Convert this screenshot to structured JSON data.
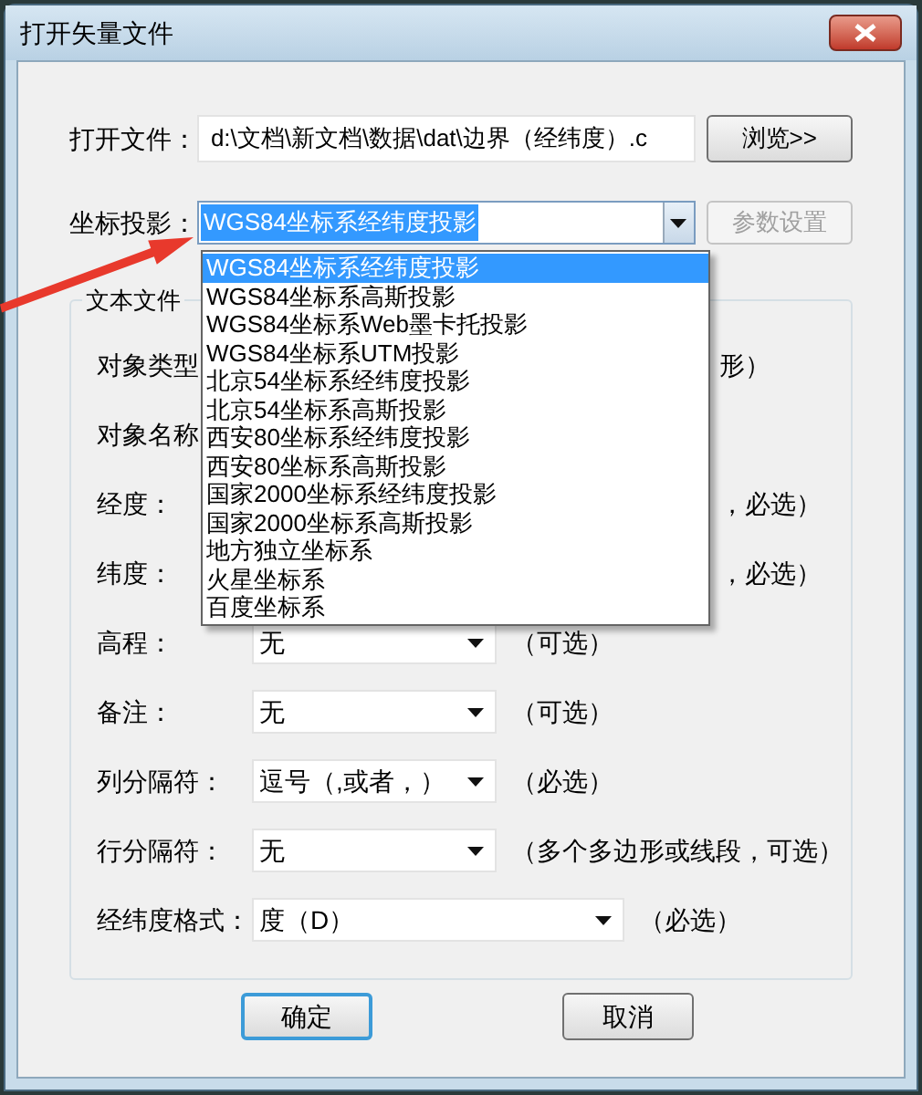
{
  "window": {
    "title": "打开矢量文件"
  },
  "file_row": {
    "label": "打开文件：",
    "value": "d:\\文档\\新文档\\数据\\dat\\边界（经纬度）.c",
    "button": "浏览>>"
  },
  "projection_row": {
    "label": "坐标投影：",
    "value": "WGS84坐标系经纬度投影",
    "button": {
      "label": "参数设置",
      "disabled": true
    },
    "dropdown": {
      "expanded": true,
      "options": [
        {
          "label": "WGS84坐标系经纬度投影",
          "selected": true
        },
        {
          "label": "WGS84坐标系高斯投影",
          "selected": false
        },
        {
          "label": "WGS84坐标系Web墨卡托投影",
          "selected": false
        },
        {
          "label": "WGS84坐标系UTM投影",
          "selected": false
        },
        {
          "label": "北京54坐标系经纬度投影",
          "selected": false
        },
        {
          "label": "北京54坐标系高斯投影",
          "selected": false
        },
        {
          "label": "西安80坐标系经纬度投影",
          "selected": false
        },
        {
          "label": "西安80坐标系高斯投影",
          "selected": false
        },
        {
          "label": "国家2000坐标系经纬度投影",
          "selected": false
        },
        {
          "label": "国家2000坐标系高斯投影",
          "selected": false
        },
        {
          "label": "地方独立坐标系",
          "selected": false
        },
        {
          "label": "火星坐标系",
          "selected": false
        },
        {
          "label": "百度坐标系",
          "selected": false
        }
      ]
    }
  },
  "group": {
    "title": "文本文件",
    "rows": [
      {
        "kind": "covered",
        "label": "对象类型",
        "note": "形）"
      },
      {
        "kind": "covered",
        "label": "对象名称"
      },
      {
        "kind": "covered",
        "label": "经度：",
        "note": "，必选）"
      },
      {
        "kind": "covered",
        "label": "纬度：",
        "note": "，必选）"
      },
      {
        "kind": "combo",
        "label": "高程：",
        "value": "无",
        "note": "（可选）"
      },
      {
        "kind": "combo",
        "label": "备注：",
        "value": "无",
        "note": "（可选）"
      },
      {
        "kind": "combo",
        "label": "列分隔符：",
        "value": "逗号（,或者，）",
        "note": "（必选）"
      },
      {
        "kind": "combo",
        "label": "行分隔符：",
        "value": "无",
        "note": "（多个多边形或线段，可选）"
      },
      {
        "kind": "wide_combo",
        "label": "经纬度格式：",
        "value": "度（D）",
        "note": "（必选）"
      }
    ]
  },
  "buttons": [
    {
      "label": "确定",
      "default": true
    },
    {
      "label": "取消",
      "default": false
    }
  ]
}
